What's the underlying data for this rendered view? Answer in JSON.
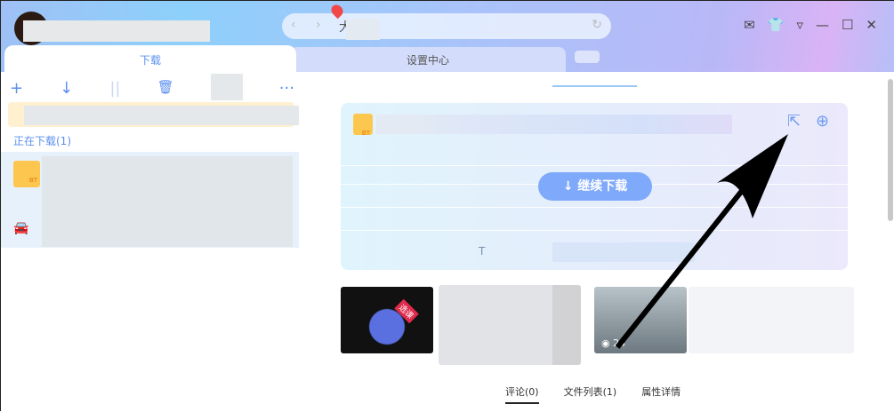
{
  "nav": {
    "back": "‹",
    "forward": "›",
    "refresh": "↻",
    "query_char": "大"
  },
  "window": {
    "mail": "✉",
    "skin": "👕",
    "menu": "▿",
    "minimize": "—",
    "maximize": "☐",
    "close": "✕"
  },
  "tabs": [
    {
      "label": "下载"
    },
    {
      "label": "设置中心"
    }
  ],
  "toolbar": {
    "add": "+",
    "download": "↓",
    "pause": "||",
    "delete": "🗑",
    "more": "···"
  },
  "left": {
    "section_label": "正在下载(1)",
    "folder_badge": "BT"
  },
  "card": {
    "folder_badge": "BT",
    "resume_label": "↓ 继续下载",
    "partial_text": "T",
    "share": "⇱",
    "download": "⊕"
  },
  "thumbs": [
    {
      "badge": "选课"
    },
    {
      "views": "◉ 24"
    }
  ],
  "detail_tabs": [
    {
      "label": "评论(0)"
    },
    {
      "label": "文件列表(1)"
    },
    {
      "label": "属性详情"
    }
  ]
}
